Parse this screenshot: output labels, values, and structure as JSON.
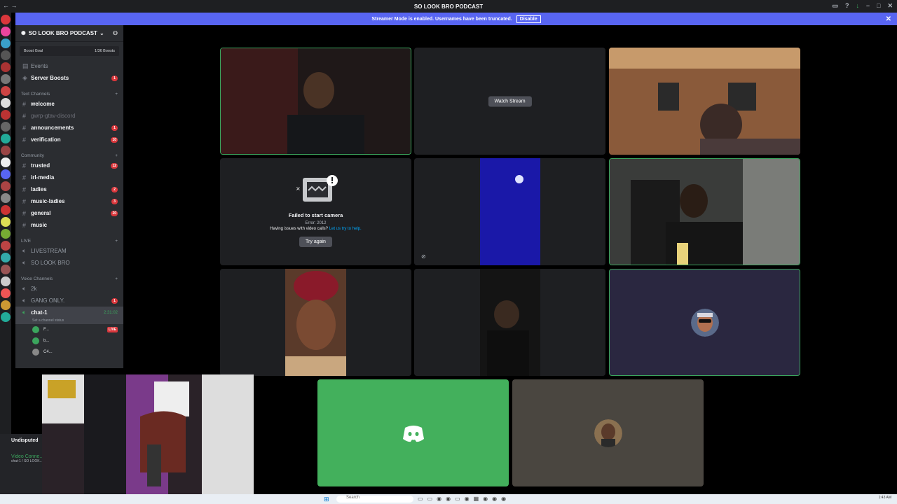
{
  "window": {
    "title": "SO LOOK BRO PODCAST"
  },
  "banner": {
    "message": "Streamer Mode is enabled. Usernames have been truncated.",
    "disable_label": "Disable"
  },
  "server": {
    "name": "SO LOOK BRO PODCAST",
    "boost_goal_label": "Boost Goal",
    "boost_count": "1/36 Boosts"
  },
  "sidebar": {
    "top_items": [
      {
        "label": "Events",
        "badge": ""
      },
      {
        "label": "Server Boosts",
        "badge": "1"
      }
    ],
    "text_channels_label": "Text Channels",
    "text_channels": [
      {
        "label": "welcome",
        "badge": ""
      },
      {
        "label": "gwrp-gtav-discord",
        "badge": ""
      },
      {
        "label": "announcements",
        "badge": "1"
      },
      {
        "label": "verification",
        "badge": "10"
      }
    ],
    "community_label": "Community",
    "community_channels": [
      {
        "label": "trusted",
        "badge": "12"
      },
      {
        "label": "irl-media",
        "badge": ""
      },
      {
        "label": "ladies",
        "badge": "2"
      },
      {
        "label": "music-ladies",
        "badge": "3"
      },
      {
        "label": "general",
        "badge": "20"
      },
      {
        "label": "music",
        "badge": ""
      }
    ],
    "live_label": "LIVE",
    "live_channels": [
      {
        "label": "LIVESTREAM"
      },
      {
        "label": "SO LOOK BRO"
      }
    ],
    "voice_channels_label": "Voice Channels",
    "voice_channels": [
      {
        "label": "2k",
        "badge": ""
      },
      {
        "label": "GANG ONLY.",
        "badge": "1"
      }
    ],
    "active_voice": {
      "label": "chat-1",
      "timer": "2:31:02",
      "status_hint": "Set a channel status"
    },
    "members": [
      {
        "name": "F...",
        "live": "LIVE"
      },
      {
        "name": "b...",
        "live": ""
      },
      {
        "name": "C4...",
        "live": ""
      }
    ]
  },
  "user_panel": {
    "label": "Undisputed",
    "voice_status": "Video Conne...",
    "voice_sub": "chat-1 / SO LOOK..."
  },
  "stage": {
    "watch_stream_label": "Watch Stream",
    "camera_error": {
      "title": "Failed to start camera",
      "error": "Error: 2012",
      "help_prefix": "Having issues with video calls?",
      "help_link": "Let us try to help.",
      "retry_label": "Try again"
    }
  },
  "taskbar": {
    "search_placeholder": "Search",
    "clock": "1:43 AM"
  },
  "colors": {
    "blurple": "#5865f2",
    "speaking_green": "#3ba55d",
    "discord_green": "#43b05c",
    "danger": "#da373c"
  }
}
